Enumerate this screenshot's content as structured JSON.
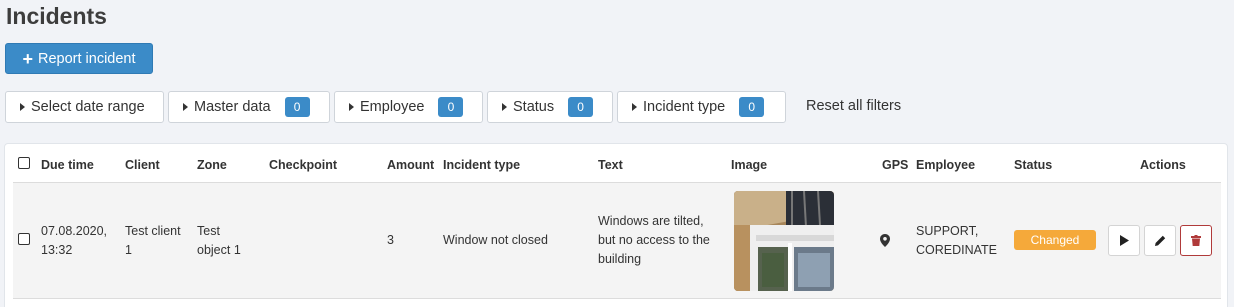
{
  "page": {
    "title": "Incidents"
  },
  "toolbar": {
    "report_label": "Report incident"
  },
  "filters": {
    "date_range": "Select date range",
    "master_data": {
      "label": "Master data",
      "count": "0"
    },
    "employee": {
      "label": "Employee",
      "count": "0"
    },
    "status": {
      "label": "Status",
      "count": "0"
    },
    "incident_type": {
      "label": "Incident type",
      "count": "0"
    },
    "reset": "Reset all filters"
  },
  "table": {
    "headers": {
      "due_time": "Due time",
      "client": "Client",
      "zone": "Zone",
      "checkpoint": "Checkpoint",
      "amount": "Amount",
      "incident_type": "Incident type",
      "text": "Text",
      "image": "Image",
      "gps": "GPS",
      "employee": "Employee",
      "status": "Status",
      "actions": "Actions"
    },
    "rows": [
      {
        "due_date": "07.08.2020,",
        "due_time": "13:32",
        "client_line1": "Test client",
        "client_line2": "1",
        "zone_line1": "Test",
        "zone_line2": "object 1",
        "checkpoint": "",
        "amount": "3",
        "incident_type": "Window not closed",
        "text_line1": "Windows are tilted,",
        "text_line2": "but no access to the",
        "text_line3": "building",
        "employee_line1": "SUPPORT,",
        "employee_line2": "COREDINATE",
        "status": "Changed"
      }
    ]
  },
  "colors": {
    "accent": "#3b8bc8",
    "status_changed": "#f5a93a",
    "delete": "#b03a3a"
  },
  "icons": {
    "gps": "map-marker-icon",
    "play": "play-icon",
    "edit": "pencil-icon",
    "delete": "trash-icon"
  }
}
